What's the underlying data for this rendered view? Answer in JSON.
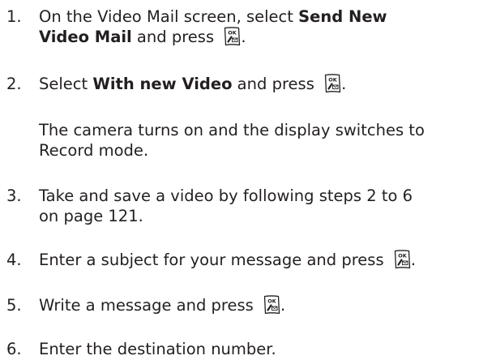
{
  "key_icon": {
    "name": "ok-menu-key-icon",
    "top_label": "OK",
    "color": "#231f20"
  },
  "steps": [
    {
      "number": "1.",
      "line1_text": "On the Video Mail screen, select ",
      "line1_bold": "Send New",
      "line2_bold": "Video Mail",
      "line2_text": " and press ",
      "line2_end": "."
    },
    {
      "number": "2.",
      "text_before": "Select ",
      "bold": "With new Video",
      "text_after": " and press ",
      "end": "."
    },
    {
      "number": "3.",
      "line1": "Take and save a video by following steps 2 to 6",
      "line2": "on page 121."
    },
    {
      "number": "4.",
      "text": "Enter a subject for your message and press ",
      "end": "."
    },
    {
      "number": "5.",
      "text": "Write a message and press ",
      "end": "."
    },
    {
      "number": "6.",
      "text": "Enter the destination number."
    }
  ],
  "note": {
    "line1": "The camera turns on and the display switches to",
    "line2": "Record mode."
  }
}
